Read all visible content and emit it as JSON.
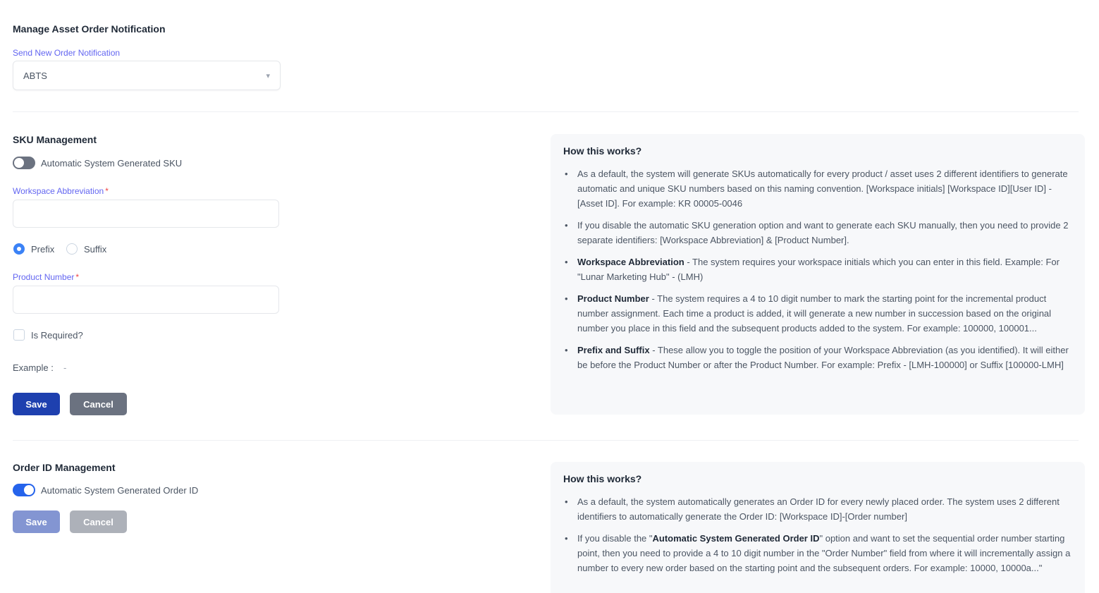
{
  "notification": {
    "title": "Manage Asset Order Notification",
    "label": "Send New Order Notification",
    "selected": "ABTS"
  },
  "sku": {
    "title": "SKU Management",
    "toggle_label": "Automatic System Generated SKU",
    "abbr_label": "Workspace Abbreviation",
    "abbr_value": "",
    "prefix_label": "Prefix",
    "suffix_label": "Suffix",
    "product_label": "Product Number",
    "product_value": "",
    "is_required_label": "Is Required?",
    "example_label": "Example :",
    "example_value": "-",
    "save_label": "Save",
    "cancel_label": "Cancel"
  },
  "sku_info": {
    "title": "How this works?",
    "items": [
      {
        "bold": "",
        "text": "As a default, the system will generate SKUs automatically for every product / asset uses 2 different identifiers to generate automatic and unique SKU numbers based on this naming convention. [Workspace initials] [Workspace ID][User ID] - [Asset ID]. For example: KR 00005-0046"
      },
      {
        "bold": "",
        "text": "If you disable the automatic SKU generation option and want to generate each SKU manually, then you need to provide 2 separate identifiers: [Workspace Abbreviation] & [Product Number]."
      },
      {
        "bold": "Workspace Abbreviation",
        "text": " - The system requires your workspace initials which you can enter in this field. Example: For \"Lunar Marketing Hub\" - (LMH)"
      },
      {
        "bold": "Product Number",
        "text": " - The system requires a 4 to 10 digit number to mark the starting point for the incremental product number assignment. Each time a product is added, it will generate a new number in succession based on the original number you place in this field and the subsequent products added to the system. For example: 100000, 100001..."
      },
      {
        "bold": "Prefix and Suffix",
        "text": " - These allow you to toggle the position of your Workspace Abbreviation (as you identified). It will either be before the Product Number or after the Product Number. For example: Prefix - [LMH-100000] or Suffix [100000-LMH]"
      }
    ]
  },
  "order": {
    "title": "Order ID Management",
    "toggle_label": "Automatic System Generated Order ID",
    "save_label": "Save",
    "cancel_label": "Cancel"
  },
  "order_info": {
    "title": "How this works?",
    "items": [
      {
        "bold": "",
        "text": "As a default, the system automatically generates an Order ID for every newly placed order. The system uses 2 different identifiers to automatically generate the Order ID: [Workspace ID]-[Order number]"
      },
      {
        "bold": "Automatic System Generated Order ID",
        "pre": "If you disable the \"",
        "post": "\" option and want to set the sequential order number starting point, then you need to provide a 4 to 10 digit number in the \"Order Number\" field from where it will incrementally assign a number to every new order based on the starting point and the subsequent orders. For example: 10000, 10000a...\""
      }
    ]
  }
}
